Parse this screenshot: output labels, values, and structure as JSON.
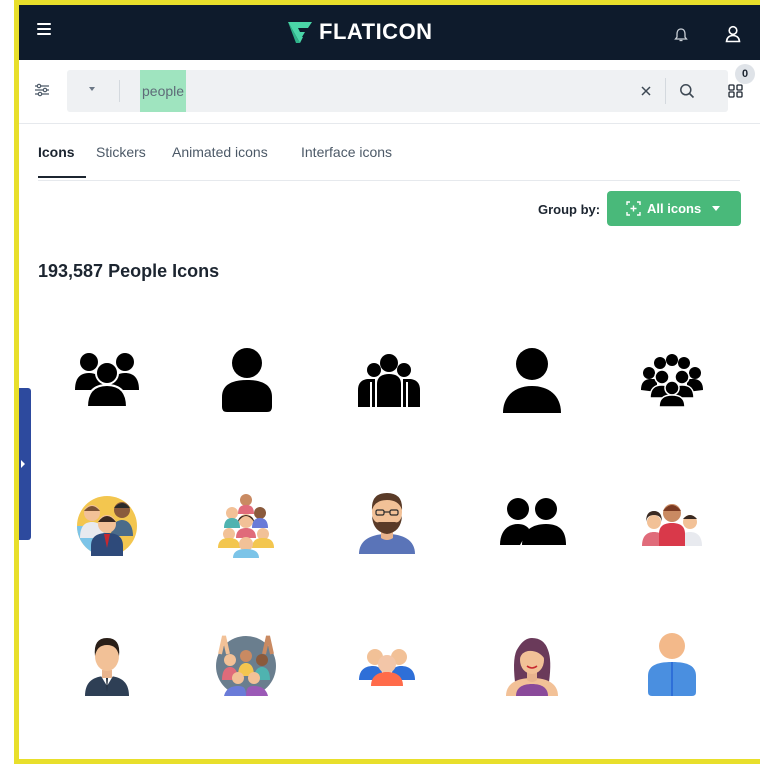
{
  "header": {
    "menu_icon": "hamburger-menu-icon",
    "logo_text": "FLATICON",
    "notification_icon": "bell-icon",
    "account_icon": "user-icon"
  },
  "search": {
    "filters_icon": "filters-icon",
    "type_dropdown_icon": "caret-down-icon",
    "query": "people",
    "clear_icon": "close-icon",
    "submit_icon": "search-icon",
    "collections_icon": "grid-icon",
    "collections_count": "0"
  },
  "tabs": [
    {
      "label": "Icons",
      "active": true
    },
    {
      "label": "Stickers",
      "active": false
    },
    {
      "label": "Animated icons",
      "active": false
    },
    {
      "label": "Interface icons",
      "active": false
    }
  ],
  "group_by": {
    "label": "Group by:",
    "button_label": "All icons"
  },
  "results": {
    "title": "193,587 People Icons"
  },
  "colors": {
    "header_bg": "#0e1b2c",
    "accent_green": "#49b97a",
    "highlight_frame": "#e8df2b",
    "side_tab": "#2d4a9e"
  },
  "icons": [
    {
      "name": "group-of-three-people-icon"
    },
    {
      "name": "single-user-icon"
    },
    {
      "name": "team-of-four-icon"
    },
    {
      "name": "user-avatar-icon"
    },
    {
      "name": "crowd-icon"
    },
    {
      "name": "business-team-colored-icon"
    },
    {
      "name": "diverse-crowd-colored-icon"
    },
    {
      "name": "bearded-man-avatar-icon"
    },
    {
      "name": "two-people-icon"
    },
    {
      "name": "family-colored-icon"
    },
    {
      "name": "businessman-avatar-icon"
    },
    {
      "name": "cheering-crowd-icon"
    },
    {
      "name": "colorful-group-icon"
    },
    {
      "name": "woman-avatar-icon"
    },
    {
      "name": "user-colored-icon"
    }
  ]
}
